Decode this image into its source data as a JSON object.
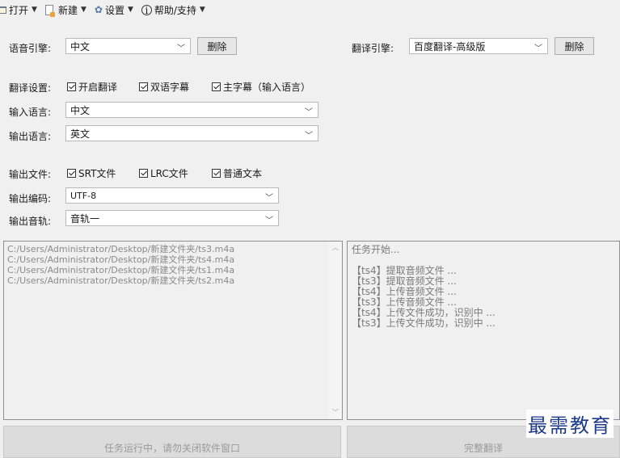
{
  "menubar": {
    "open": "打开",
    "new": "新建",
    "settings": "设置",
    "help": "帮助/支持"
  },
  "speech_engine": {
    "label": "语音引擎:",
    "value": "中文",
    "delete": "删除"
  },
  "translate_engine": {
    "label": "翻译引擎:",
    "value": "百度翻译-高级版",
    "delete": "删除"
  },
  "translate_settings": {
    "label": "翻译设置:",
    "enable": "开启翻译",
    "bilingual": "双语字幕",
    "main_subtitle": "主字幕（输入语言）"
  },
  "input_lang": {
    "label": "输入语言:",
    "value": "中文"
  },
  "output_lang": {
    "label": "输出语言:",
    "value": "英文"
  },
  "output_files": {
    "label": "输出文件:",
    "srt": "SRT文件",
    "lrc": "LRC文件",
    "txt": "普通文本"
  },
  "output_encoding": {
    "label": "输出编码:",
    "value": "UTF-8"
  },
  "output_track": {
    "label": "输出音轨:",
    "value": "音轨一"
  },
  "file_list": [
    "C:/Users/Administrator/Desktop/新建文件夹/ts3.m4a",
    "C:/Users/Administrator/Desktop/新建文件夹/ts4.m4a",
    "C:/Users/Administrator/Desktop/新建文件夹/ts1.m4a",
    "C:/Users/Administrator/Desktop/新建文件夹/ts2.m4a"
  ],
  "log": {
    "header": "任务开始...",
    "lines": [
      "【ts4】提取音频文件 ...",
      "【ts3】提取音频文件 ...",
      "【ts4】上传音频文件 ...",
      "【ts3】上传音频文件 ...",
      "【ts4】上传文件成功，识别中 ...",
      "【ts3】上传文件成功，识别中 ..."
    ]
  },
  "bottom": {
    "running": "任务运行中，请勿关闭软件窗口",
    "complete": "完整翻译"
  },
  "watermark": "最需教育"
}
